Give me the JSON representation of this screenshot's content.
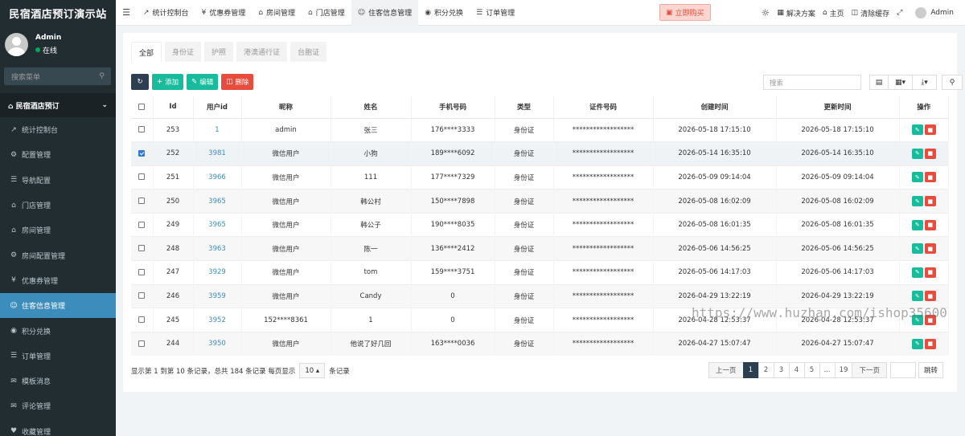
{
  "app": {
    "title": "民宿酒店预订演示站"
  },
  "user": {
    "name": "Admin",
    "status": "在线"
  },
  "sidebar": {
    "search_placeholder": "搜索菜单",
    "header": "民宿酒店预订",
    "items": [
      {
        "label": "统计控制台",
        "icon": "chart-icon"
      },
      {
        "label": "配置管理",
        "icon": "gear-icon"
      },
      {
        "label": "导航配置",
        "icon": "list-icon"
      },
      {
        "label": "门店管理",
        "icon": "bank-icon"
      },
      {
        "label": "房间管理",
        "icon": "home-icon"
      },
      {
        "label": "房间配置管理",
        "icon": "gear-icon"
      },
      {
        "label": "优惠券管理",
        "icon": "yen-icon"
      },
      {
        "label": "住客信息管理",
        "icon": "user-icon",
        "active": true
      },
      {
        "label": "积分兑换",
        "icon": "circle-icon"
      },
      {
        "label": "订单管理",
        "icon": "list-icon"
      },
      {
        "label": "模板消息",
        "icon": "envelope-icon"
      },
      {
        "label": "评论管理",
        "icon": "comment-icon"
      },
      {
        "label": "收藏管理",
        "icon": "heart-icon"
      }
    ]
  },
  "topnav": {
    "tabs": [
      {
        "label": "统计控制台",
        "icon": "chart-icon"
      },
      {
        "label": "优惠券管理",
        "icon": "yen-icon"
      },
      {
        "label": "房间管理",
        "icon": "home-icon"
      },
      {
        "label": "门店管理",
        "icon": "bank-icon"
      },
      {
        "label": "住客信息管理",
        "icon": "user-icon",
        "active": true
      },
      {
        "label": "积分兑换",
        "icon": "circle-icon"
      },
      {
        "label": "订单管理",
        "icon": "list-icon"
      }
    ],
    "buy": "立即购买",
    "solutions": "解决方案",
    "home": "主页",
    "clear_cache": "清除缓存",
    "user": "Admin"
  },
  "content_tabs": [
    "全部",
    "身份证",
    "护照",
    "港澳通行证",
    "台胞证"
  ],
  "toolbar": {
    "add": "添加",
    "edit": "编辑",
    "delete": "删除",
    "search_placeholder": "搜索"
  },
  "table": {
    "headers": [
      "Id",
      "用户id",
      "昵称",
      "姓名",
      "手机号码",
      "类型",
      "证件号码",
      "创建时间",
      "更新时间",
      "操作"
    ],
    "rows": [
      {
        "id": "253",
        "uid": "1",
        "nick": "admin",
        "name": "张三",
        "phone": "176****3333",
        "type": "身份证",
        "cert": "******************",
        "created": "2026-05-18 17:15:10",
        "updated": "2026-05-18 17:15:10",
        "checked": false
      },
      {
        "id": "252",
        "uid": "3981",
        "nick": "微信用户",
        "name": "小狗",
        "phone": "189****6092",
        "type": "身份证",
        "cert": "******************",
        "created": "2026-05-14 16:35:10",
        "updated": "2026-05-14 16:35:10",
        "checked": true
      },
      {
        "id": "251",
        "uid": "3966",
        "nick": "微信用户",
        "name": "111",
        "phone": "177****7329",
        "type": "身份证",
        "cert": "******************",
        "created": "2026-05-09 09:14:04",
        "updated": "2026-05-09 09:14:04",
        "checked": false
      },
      {
        "id": "250",
        "uid": "3965",
        "nick": "微信用户",
        "name": "韩公村",
        "phone": "150****7898",
        "type": "身份证",
        "cert": "******************",
        "created": "2026-05-08 16:02:09",
        "updated": "2026-05-08 16:02:09",
        "checked": false
      },
      {
        "id": "249",
        "uid": "3965",
        "nick": "微信用户",
        "name": "韩公子",
        "phone": "190****8035",
        "type": "身份证",
        "cert": "******************",
        "created": "2026-05-08 16:01:35",
        "updated": "2026-05-08 16:01:35",
        "checked": false
      },
      {
        "id": "248",
        "uid": "3963",
        "nick": "微信用户",
        "name": "陈一",
        "phone": "136****2412",
        "type": "身份证",
        "cert": "******************",
        "created": "2026-05-06 14:56:25",
        "updated": "2026-05-06 14:56:25",
        "checked": false
      },
      {
        "id": "247",
        "uid": "3929",
        "nick": "微信用户",
        "name": "tom",
        "phone": "159****3751",
        "type": "身份证",
        "cert": "******************",
        "created": "2026-05-06 14:17:03",
        "updated": "2026-05-06 14:17:03",
        "checked": false
      },
      {
        "id": "246",
        "uid": "3959",
        "nick": "微信用户",
        "name": "Candy",
        "phone": "0",
        "type": "身份证",
        "cert": "******************",
        "created": "2026-04-29 13:22:19",
        "updated": "2026-04-29 13:22:19",
        "checked": false
      },
      {
        "id": "245",
        "uid": "3952",
        "nick": "152****8361",
        "name": "1",
        "phone": "0",
        "type": "身份证",
        "cert": "******************",
        "created": "2026-04-28 12:53:37",
        "updated": "2026-04-28 12:53:37",
        "checked": false
      },
      {
        "id": "244",
        "uid": "3950",
        "nick": "微信用户",
        "name": "他说了好几回",
        "phone": "163****0036",
        "type": "身份证",
        "cert": "******************",
        "created": "2026-04-27 15:07:47",
        "updated": "2026-04-27 15:07:47",
        "checked": false
      }
    ]
  },
  "footer": {
    "summary": "显示第 1 到第 10 条记录，总共 184 条记录 每页显示",
    "pagesize": "10",
    "suffix": "条记录"
  },
  "pager": {
    "prev": "上一页",
    "pages": [
      "1",
      "2",
      "3",
      "4",
      "5",
      "...",
      "19"
    ],
    "next": "下一页",
    "jump": "跳转"
  },
  "watermark": "https://www.huzhan.com/ishop35600"
}
